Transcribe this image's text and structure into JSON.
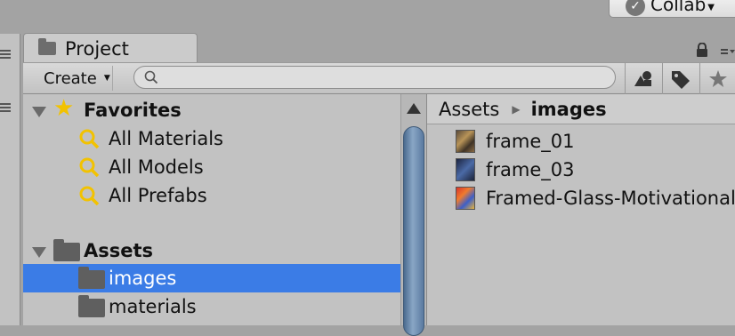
{
  "header": {
    "collab_label": "Collab"
  },
  "tab": {
    "title": "Project"
  },
  "toolbar": {
    "create_label": "Create",
    "search": {
      "value": "",
      "placeholder": ""
    },
    "icons": [
      "search-by-type-icon",
      "tag-icon",
      "star-icon"
    ]
  },
  "tree": {
    "favorites": {
      "label": "Favorites",
      "items": [
        "All Materials",
        "All Models",
        "All Prefabs"
      ]
    },
    "assets": {
      "label": "Assets",
      "items": [
        "images",
        "materials"
      ],
      "selected": "images"
    }
  },
  "content": {
    "breadcrumb": {
      "root": "Assets",
      "current": "images"
    },
    "files": [
      "frame_01",
      "frame_03",
      "Framed-Glass-Motivational"
    ]
  },
  "colors": {
    "selection": "#3b7ce6",
    "panel_bg": "#c2c2c2",
    "star": "#f2c200",
    "magnifier": "#f2c200"
  }
}
